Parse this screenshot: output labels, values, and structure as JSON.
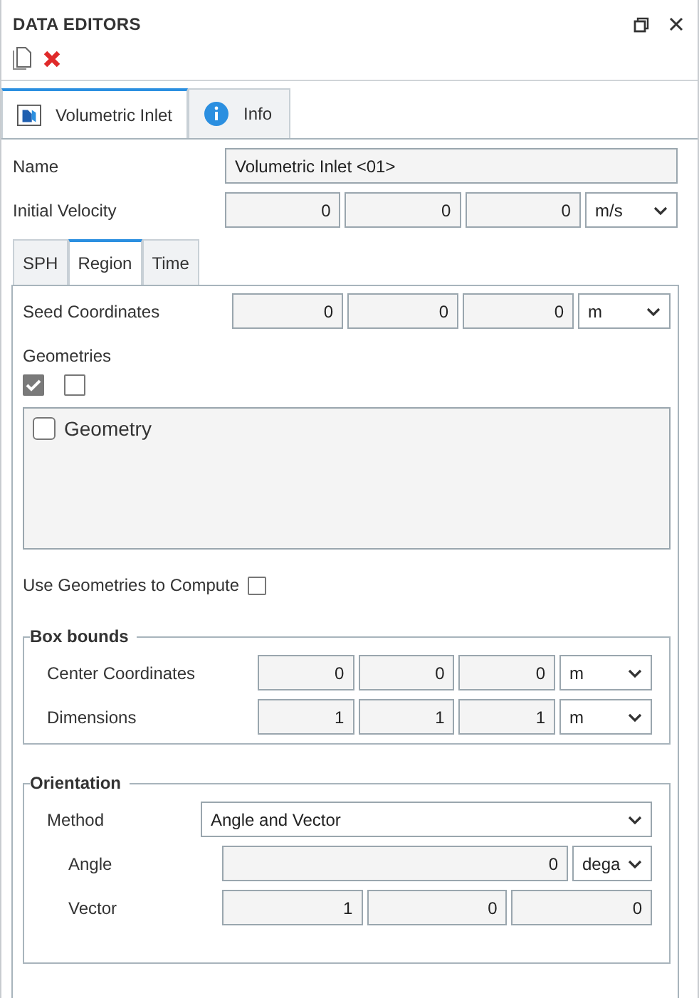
{
  "window": {
    "title": "DATA EDITORS"
  },
  "tabs": [
    {
      "label": "Volumetric Inlet",
      "selected": true,
      "kind": "object"
    },
    {
      "label": "Info",
      "selected": false,
      "kind": "info"
    }
  ],
  "name": {
    "label": "Name",
    "value": "Volumetric Inlet <01>"
  },
  "initial_velocity": {
    "label": "Initial Velocity",
    "values": [
      "0",
      "0",
      "0"
    ],
    "unit": "m/s"
  },
  "subtabs": [
    {
      "label": "SPH",
      "selected": false
    },
    {
      "label": "Region",
      "selected": true
    },
    {
      "label": "Time",
      "selected": false
    }
  ],
  "region": {
    "seed_coordinates": {
      "label": "Seed Coordinates",
      "values": [
        "0",
        "0",
        "0"
      ],
      "unit": "m"
    },
    "geometries": {
      "label": "Geometries",
      "toggles": [
        {
          "checked": true
        },
        {
          "checked": false
        }
      ],
      "items": [
        {
          "label": "Geometry",
          "checked": false
        }
      ]
    },
    "use_geometries": {
      "label": "Use Geometries to Compute",
      "checked": false
    },
    "box_bounds": {
      "title": "Box bounds",
      "rows": [
        {
          "label": "Center Coordinates",
          "values": [
            "0",
            "0",
            "0"
          ],
          "unit": "m"
        },
        {
          "label": "Dimensions",
          "values": [
            "1",
            "1",
            "1"
          ],
          "unit": "m"
        }
      ]
    },
    "orientation": {
      "title": "Orientation",
      "method": {
        "label": "Method",
        "value": "Angle and Vector"
      },
      "angle": {
        "label": "Angle",
        "value": "0",
        "unit": "dega"
      },
      "vector": {
        "label": "Vector",
        "values": [
          "1",
          "0",
          "0"
        ]
      }
    }
  }
}
